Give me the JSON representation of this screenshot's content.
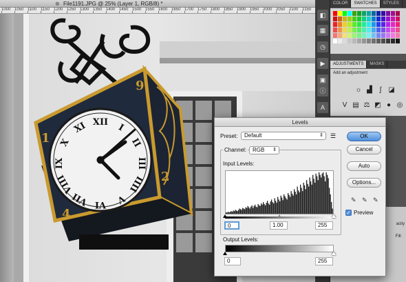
{
  "document": {
    "tab_title": "File1191.JPG @ 25% (Layer 1, RGB/8) *",
    "ruler_labels": [
      "1000",
      "1050",
      "1100",
      "1150",
      "1200",
      "1250",
      "1300",
      "1350",
      "1400",
      "1450",
      "1500",
      "1550",
      "1600",
      "1650",
      "1700",
      "1750",
      "1800",
      "1850",
      "1900",
      "1950",
      "2000",
      "2050",
      "2100",
      "2150",
      "2200"
    ]
  },
  "clock_numerals": {
    "dial": [
      "XII",
      "I",
      "II",
      "III",
      "IIII",
      "V",
      "VI",
      "VII",
      "VIII",
      "IX",
      "X",
      "XI"
    ],
    "side_left_top": "1",
    "side_left_bottom": "4",
    "side_right_top": "9",
    "side_right_bottom": "2"
  },
  "panels": {
    "top_tabs": [
      "COLOR",
      "SWATCHES",
      "STYLES"
    ],
    "top_active": "SWATCHES",
    "adj_tabs": [
      "ADJUSTMENTS",
      "MASKS"
    ],
    "adj_active": "ADJUSTMENTS",
    "adj_hint": "Add an adjustment",
    "side_fragments": {
      "a": "acity",
      "b": "Fill:"
    }
  },
  "levels": {
    "title": "Levels",
    "preset_label": "Preset:",
    "preset_value": "Default",
    "channel_label": "Channel:",
    "channel_value": "RGB",
    "input_levels_label": "Input Levels:",
    "input_black": "0",
    "input_gamma": "1.00",
    "input_white": "255",
    "output_levels_label": "Output Levels:",
    "output_black": "0",
    "output_white": "255",
    "buttons": {
      "ok": "OK",
      "cancel": "Cancel",
      "auto": "Auto",
      "options": "Options..."
    },
    "preview_label": "Preview",
    "preview_checked": true,
    "histogram": [
      2,
      2,
      3,
      2,
      3,
      4,
      3,
      5,
      4,
      6,
      5,
      4,
      6,
      8,
      7,
      6,
      9,
      8,
      7,
      10,
      9,
      12,
      10,
      8,
      11,
      13,
      9,
      12,
      14,
      11,
      10,
      15,
      13,
      12,
      16,
      14,
      18,
      15,
      13,
      17,
      20,
      16,
      14,
      19,
      22,
      18,
      16,
      24,
      20,
      17,
      26,
      22,
      19,
      28,
      25,
      21,
      30,
      27,
      24,
      22,
      32,
      29,
      26,
      35,
      31,
      28,
      38,
      34,
      30,
      42,
      36,
      33,
      45,
      40,
      35,
      48,
      44,
      38,
      52,
      46,
      42,
      56,
      50,
      45,
      60,
      54,
      48,
      62,
      58,
      52,
      64,
      60,
      56,
      62,
      64,
      58,
      50,
      64,
      60,
      55,
      40,
      30,
      18,
      8
    ]
  }
}
